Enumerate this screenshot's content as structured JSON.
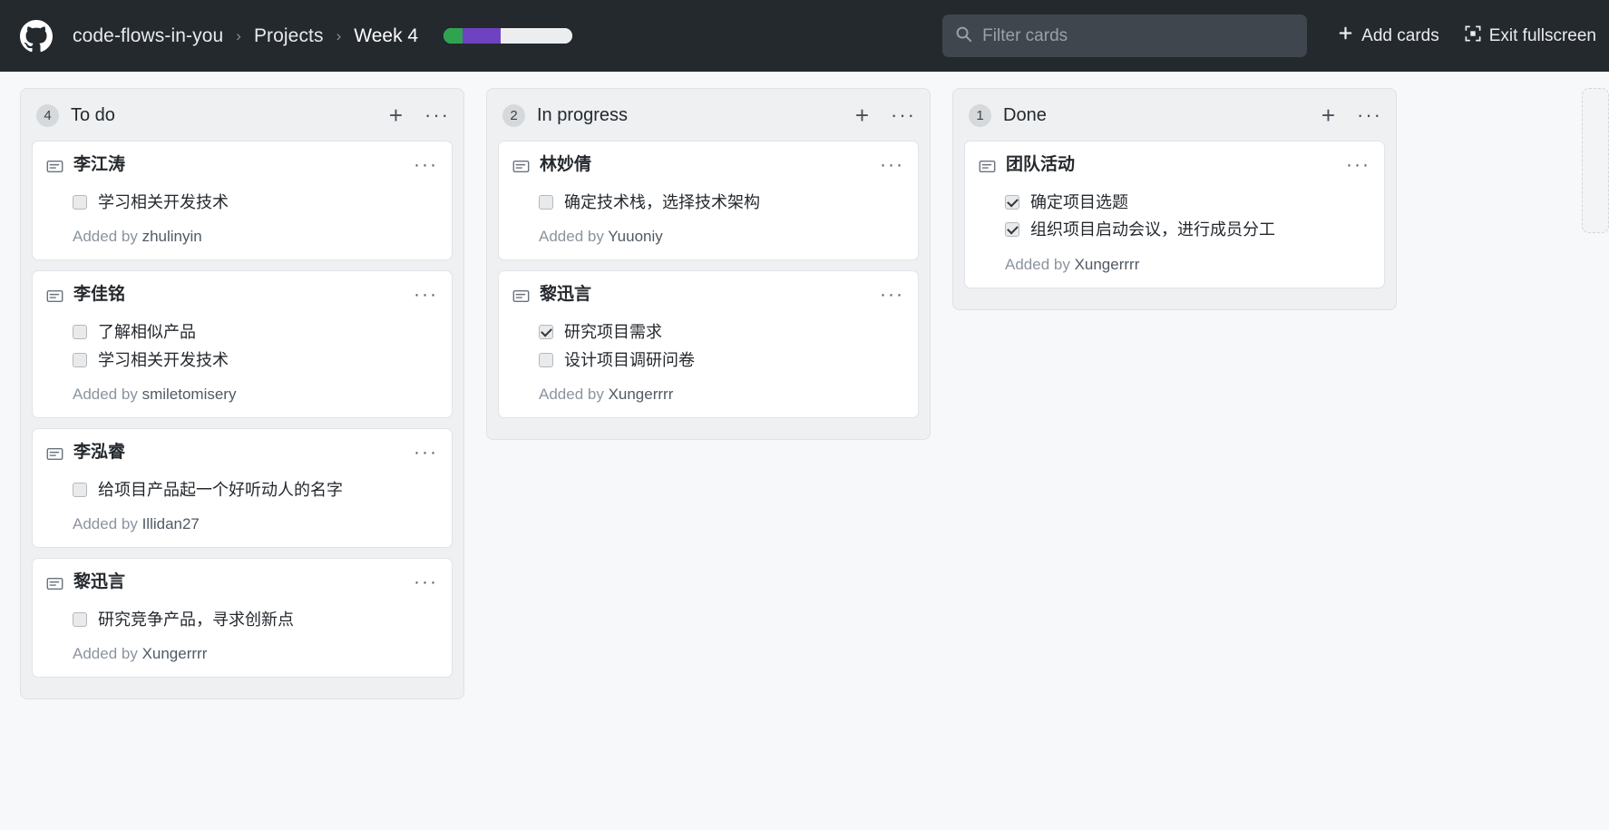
{
  "header": {
    "logo": "github-logo",
    "breadcrumb": {
      "repo": "code-flows-in-you",
      "separator": "›",
      "section": "Projects",
      "current": "Week 4"
    },
    "progress": {
      "segments": [
        {
          "name": "done",
          "color": "#2ea44f",
          "percent": 15
        },
        {
          "name": "in-progress",
          "color": "#6f42c1",
          "percent": 29
        },
        {
          "name": "todo",
          "color": "#ebedef",
          "percent": 56
        }
      ]
    },
    "search": {
      "placeholder": "Filter cards",
      "value": ""
    },
    "add_cards_label": "Add cards",
    "exit_fullscreen_label": "Exit fullscreen"
  },
  "board": {
    "columns": [
      {
        "id": "todo",
        "title": "To do",
        "count": "4",
        "add_label": "+",
        "menu_label": "…",
        "cards": [
          {
            "title": "李江涛",
            "menu": "…",
            "tasks": [
              {
                "label": "学习相关开发技术",
                "checked": false
              }
            ],
            "added_prefix": "Added by",
            "added_user": "zhulinyin"
          },
          {
            "title": "李佳铭",
            "menu": "…",
            "tasks": [
              {
                "label": "了解相似产品",
                "checked": false
              },
              {
                "label": "学习相关开发技术",
                "checked": false
              }
            ],
            "added_prefix": "Added by",
            "added_user": "smiletomisery"
          },
          {
            "title": "李泓睿",
            "menu": "…",
            "tasks": [
              {
                "label": "给项目产品起一个好听动人的名字",
                "checked": false
              }
            ],
            "added_prefix": "Added by",
            "added_user": "Illidan27"
          },
          {
            "title": "黎迅言",
            "menu": "…",
            "tasks": [
              {
                "label": "研究竞争产品，寻求创新点",
                "checked": false
              }
            ],
            "added_prefix": "Added by",
            "added_user": "Xungerrrr"
          }
        ]
      },
      {
        "id": "in-progress",
        "title": "In progress",
        "count": "2",
        "add_label": "+",
        "menu_label": "…",
        "cards": [
          {
            "title": "林妙倩",
            "menu": "…",
            "tasks": [
              {
                "label": "确定技术栈，选择技术架构",
                "checked": false
              }
            ],
            "added_prefix": "Added by",
            "added_user": "Yuuoniy"
          },
          {
            "title": "黎迅言",
            "menu": "…",
            "tasks": [
              {
                "label": "研究项目需求",
                "checked": true
              },
              {
                "label": "设计项目调研问卷",
                "checked": false
              }
            ],
            "added_prefix": "Added by",
            "added_user": "Xungerrrr"
          }
        ]
      },
      {
        "id": "done",
        "title": "Done",
        "count": "1",
        "add_label": "+",
        "menu_label": "…",
        "cards": [
          {
            "title": "团队活动",
            "menu": "…",
            "tasks": [
              {
                "label": "确定项目选题",
                "checked": true
              },
              {
                "label": "组织项目启动会议，进行成员分工",
                "checked": true
              }
            ],
            "added_prefix": "Added by",
            "added_user": "Xungerrrr"
          }
        ]
      }
    ]
  }
}
